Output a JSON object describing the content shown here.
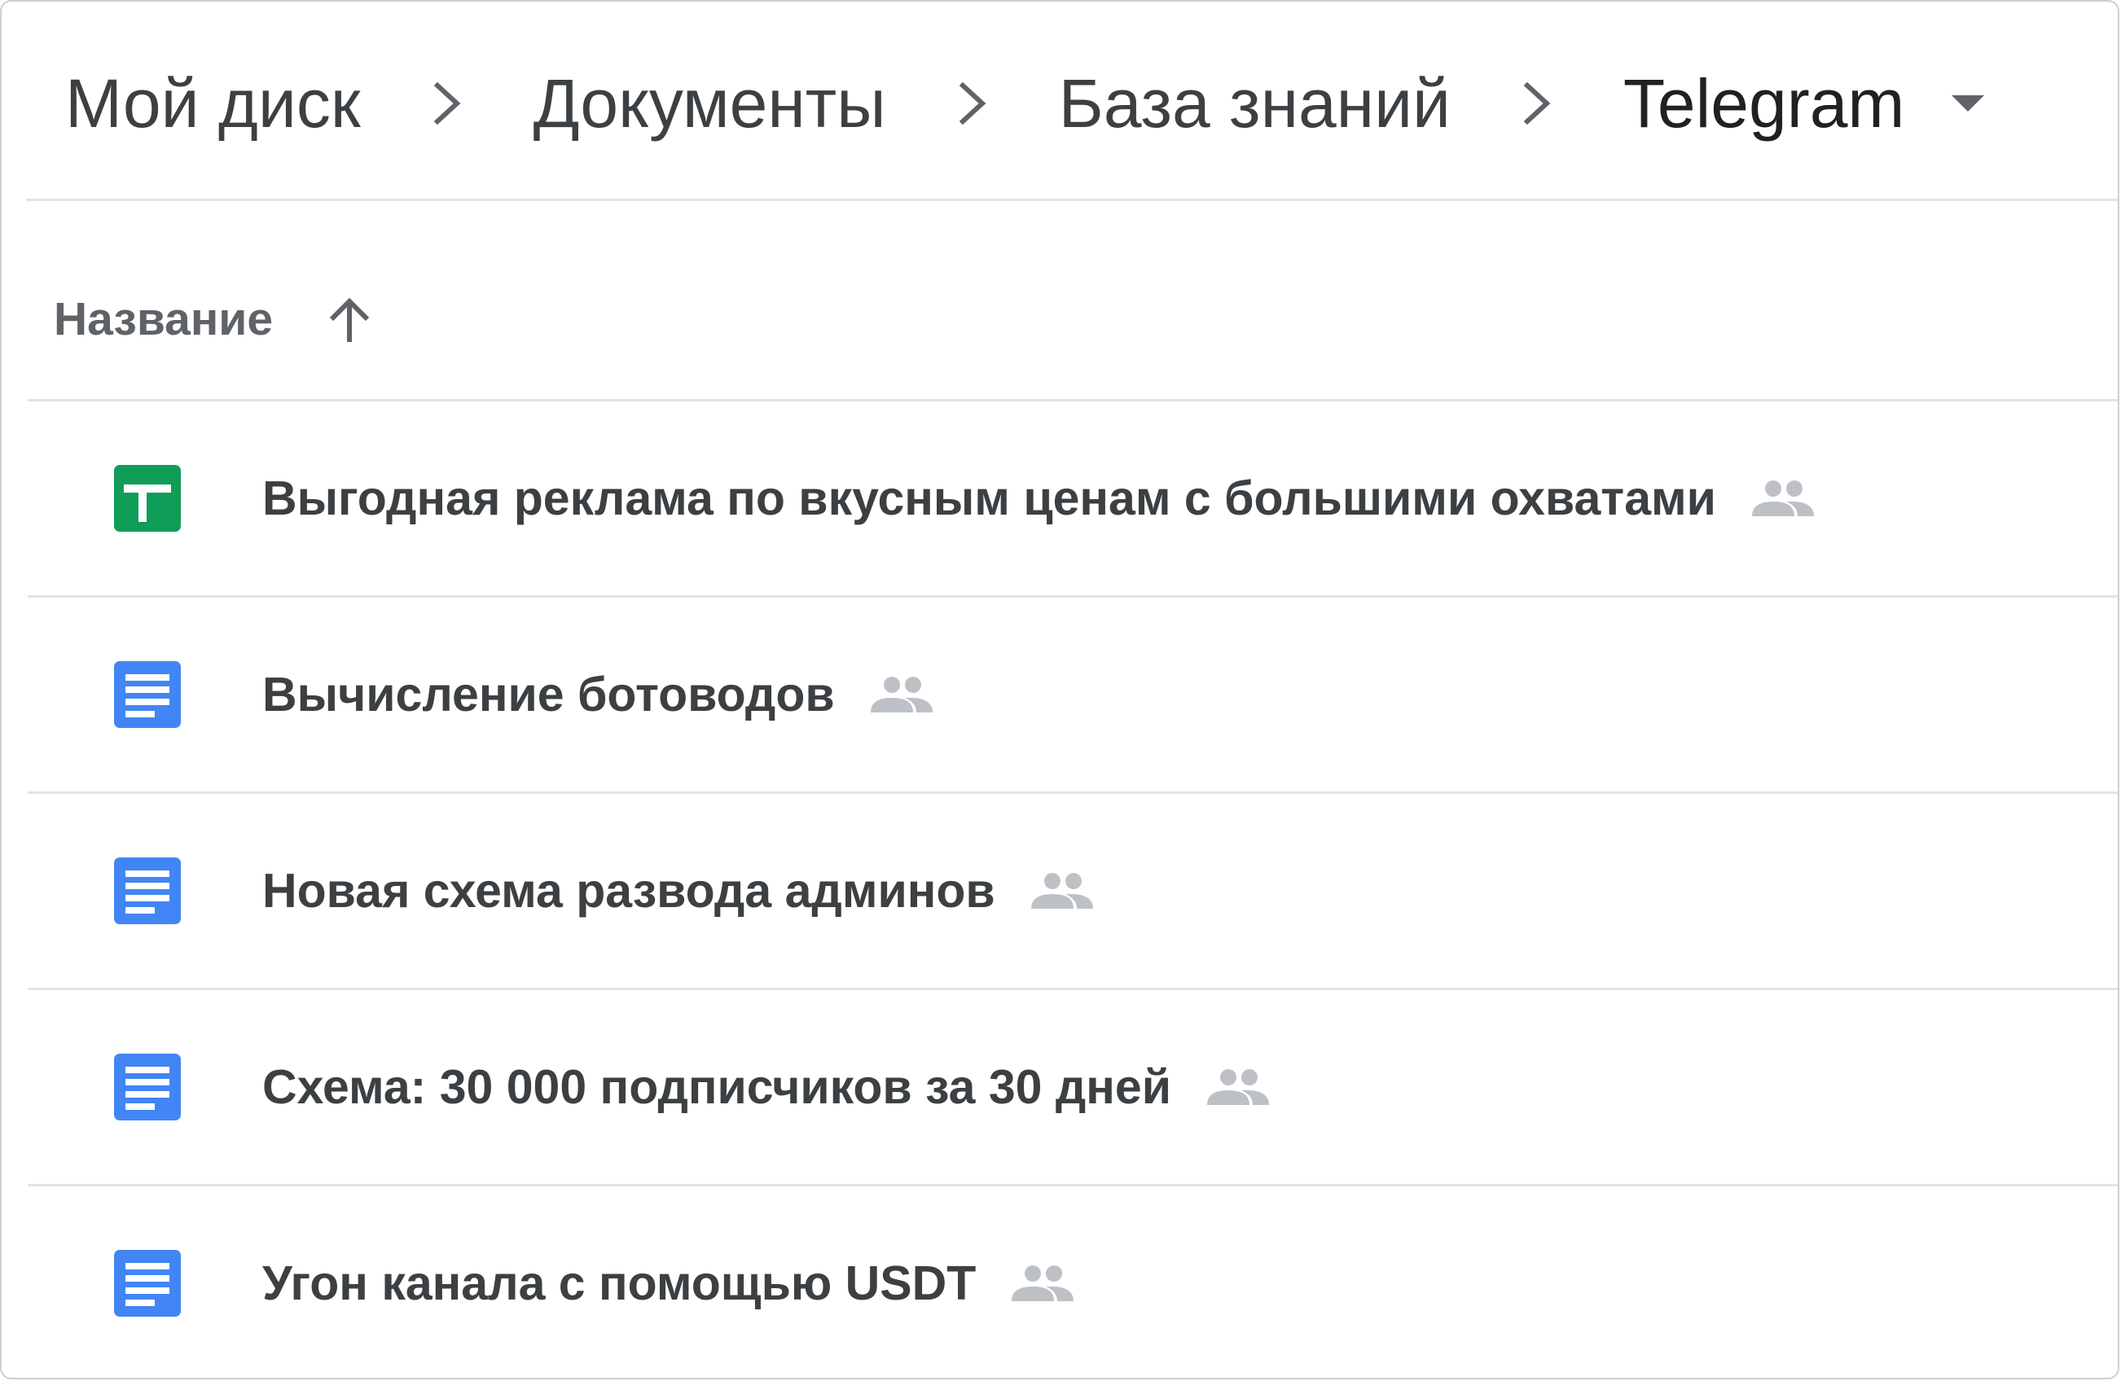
{
  "breadcrumb": {
    "items": [
      "Мой диск",
      "Документы",
      "База знаний",
      "Telegram"
    ],
    "separator_icon": "chevron-right-icon",
    "dropdown_icon": "caret-down-icon"
  },
  "list_header": {
    "column_title": "Название",
    "sort_icon": "arrow-up-icon",
    "sort_direction": "ascending"
  },
  "files": [
    {
      "name": "Выгодная реклама по вкусным ценам с большими охватами",
      "type": "spreadsheet",
      "icon": "google-sheets-icon",
      "shared": true
    },
    {
      "name": "Вычисление ботоводов",
      "type": "document",
      "icon": "google-docs-icon",
      "shared": true
    },
    {
      "name": "Новая схема развода админов",
      "type": "document",
      "icon": "google-docs-icon",
      "shared": true
    },
    {
      "name": "Схема: 30 000 подписчиков за 30 дней",
      "type": "document",
      "icon": "google-docs-icon",
      "shared": true
    },
    {
      "name": "Угон канала с помощью USDT",
      "type": "document",
      "icon": "google-docs-icon",
      "shared": true
    }
  ],
  "colors": {
    "sheets_green": "#0f9d58",
    "docs_blue": "#4285f4",
    "text_primary": "#3c4043",
    "text_secondary": "#5f6368",
    "icon_gray": "#bdc1c6",
    "divider": "#e2e3e5"
  }
}
